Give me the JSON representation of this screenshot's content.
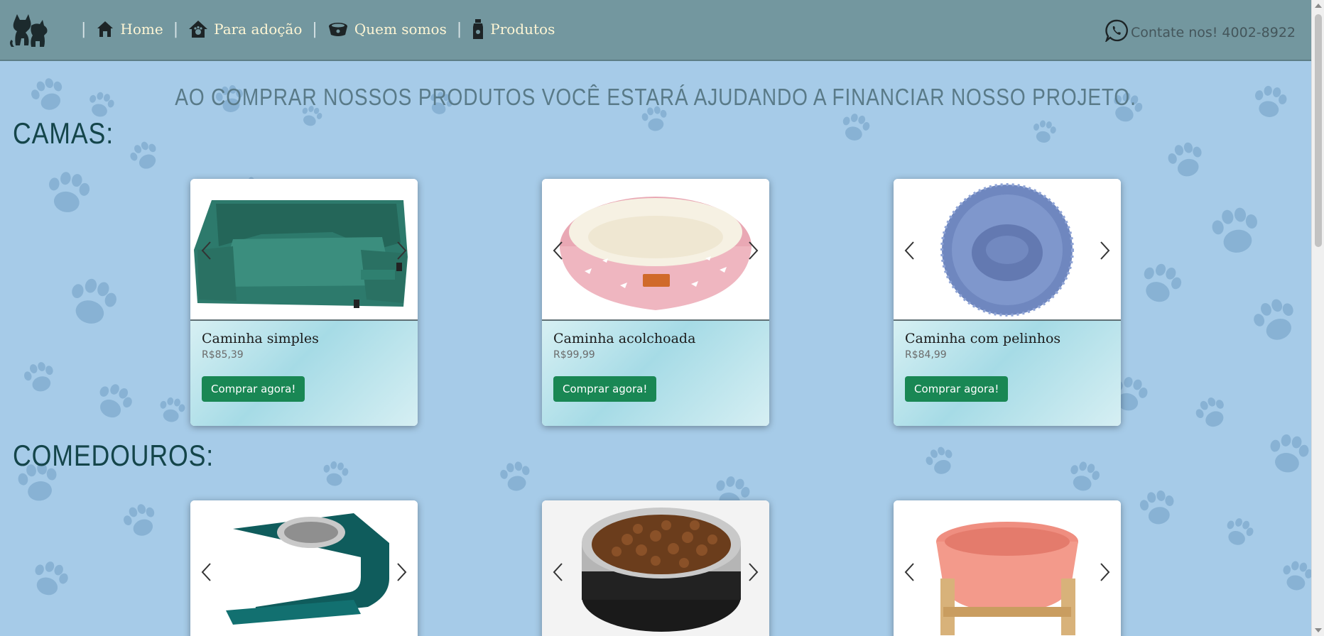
{
  "nav": {
    "logo_icon": "cat-dog-logo-icon",
    "items": [
      {
        "label": "Home",
        "icon": "house-icon"
      },
      {
        "label": "Para adoção",
        "icon": "pet-house-icon"
      },
      {
        "label": "Quem somos",
        "icon": "pet-bowl-icon"
      },
      {
        "label": "Produtos",
        "icon": "bottle-icon"
      }
    ],
    "contact": {
      "icon": "whatsapp-icon",
      "text": "Contate nos! 4002-8922"
    }
  },
  "banner": "AO COMPRAR NOSSOS PRODUTOS VOCÊ ESTARÁ AJUDANDO A FINANCIAR NOSSO PROJETO.",
  "sections": [
    {
      "title": "CAMAS:",
      "products": [
        {
          "name": "Caminha simples",
          "price": "R$85,39",
          "button": "Comprar agora!",
          "image": "green-sofa-bed"
        },
        {
          "name": "Caminha acolchoada",
          "price": "R$99,99",
          "button": "Comprar agora!",
          "image": "pink-padded-bed"
        },
        {
          "name": "Caminha com pelinhos",
          "price": "R$84,99",
          "button": "Comprar agora!",
          "image": "blue-fluffy-bed"
        }
      ]
    },
    {
      "title": "COMEDOUROS:",
      "products": [
        {
          "image": "green-stand-bowl"
        },
        {
          "image": "food-bowl"
        },
        {
          "image": "pink-bowl-wood-stand"
        }
      ]
    }
  ],
  "colors": {
    "navbar": "#73979f",
    "background": "#a6cbe8",
    "nav_text": "#fdf5d4",
    "button": "#198754",
    "section_title": "#14454a"
  }
}
